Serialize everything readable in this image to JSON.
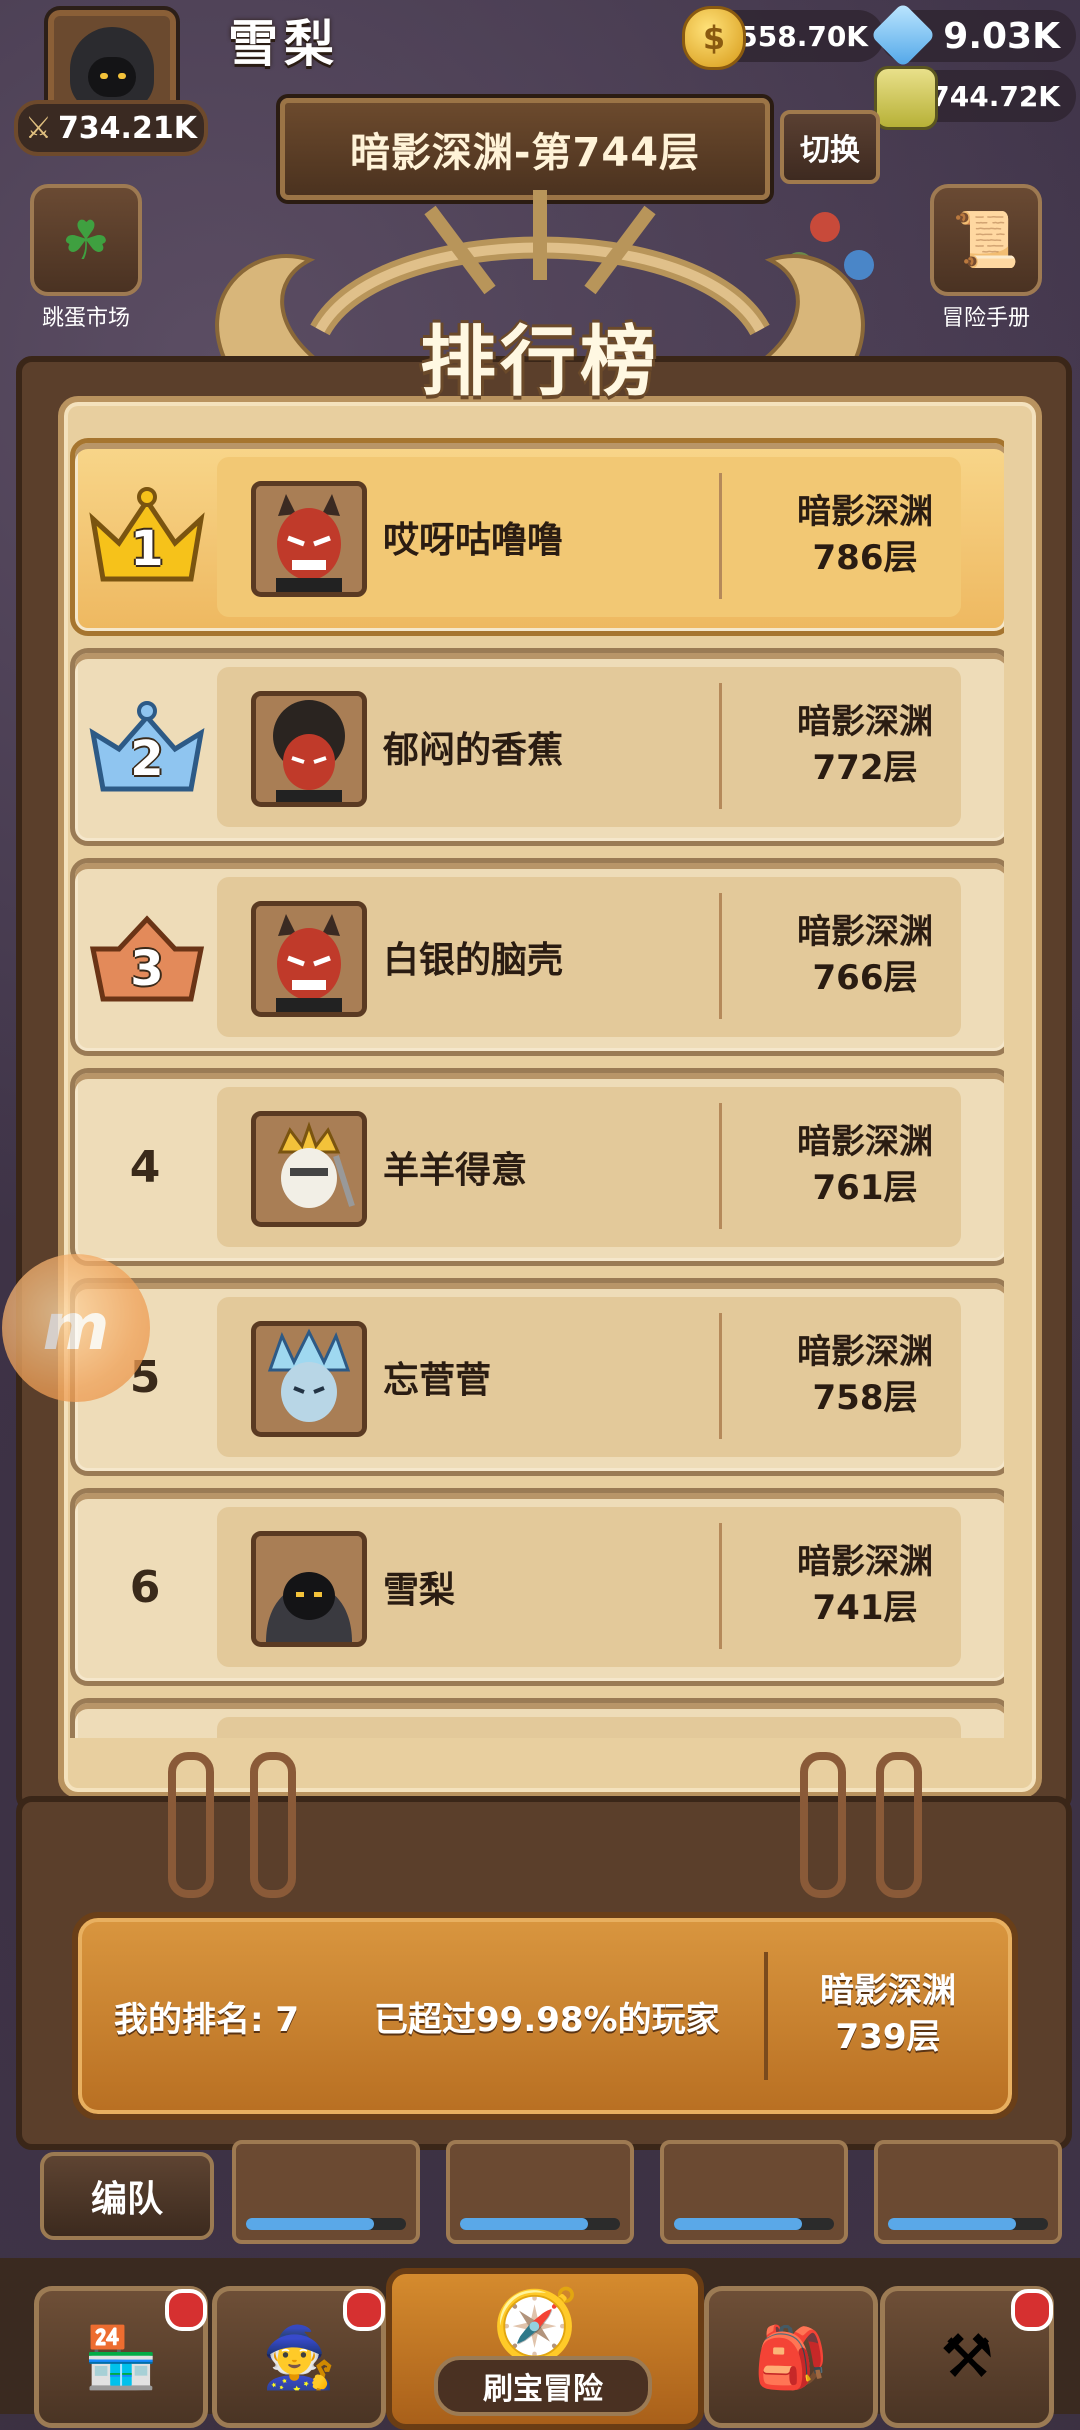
{
  "hud": {
    "player_name": "雪梨",
    "power": "734.21K",
    "gold": "558.70K",
    "gems": "9.03K",
    "potion": "744.72K"
  },
  "banner": {
    "floor_title": "暗影深渊-第744层",
    "switch_label": "切换"
  },
  "side": {
    "left_label": "跳蛋市场",
    "right_label": "冒险手册"
  },
  "leaderboard": {
    "title": "排行榜",
    "rows": [
      {
        "rank": "1",
        "name": "哎呀咕噜噜",
        "dungeon": "暗影深渊",
        "floor": "786层",
        "avatar": "red-demon"
      },
      {
        "rank": "2",
        "name": "郁闷的香蕉",
        "dungeon": "暗影深渊",
        "floor": "772层",
        "avatar": "afro-demon"
      },
      {
        "rank": "3",
        "name": "白银的脑壳",
        "dungeon": "暗影深渊",
        "floor": "766层",
        "avatar": "red-demon"
      },
      {
        "rank": "4",
        "name": "羊羊得意",
        "dungeon": "暗影深渊",
        "floor": "761层",
        "avatar": "crowned-knight"
      },
      {
        "rank": "5",
        "name": "忘菅菅",
        "dungeon": "暗影深渊",
        "floor": "758层",
        "avatar": "ice-spirit"
      },
      {
        "rank": "6",
        "name": "雪梨",
        "dungeon": "暗影深渊",
        "floor": "741层",
        "avatar": "hooded-rogue"
      }
    ]
  },
  "my_rank": {
    "rank_label": "我的排名: 7",
    "percent_label": "已超过99.98%的玩家",
    "dungeon": "暗影深渊",
    "floor": "739层"
  },
  "bottom": {
    "team_label": "编队",
    "center_label": "刷宝冒险"
  },
  "colors": {
    "gold_row": "#f2c874",
    "row_bg": "#eedcb8",
    "my_rank_bg": "#c97f2c",
    "notification": "#d63030"
  }
}
